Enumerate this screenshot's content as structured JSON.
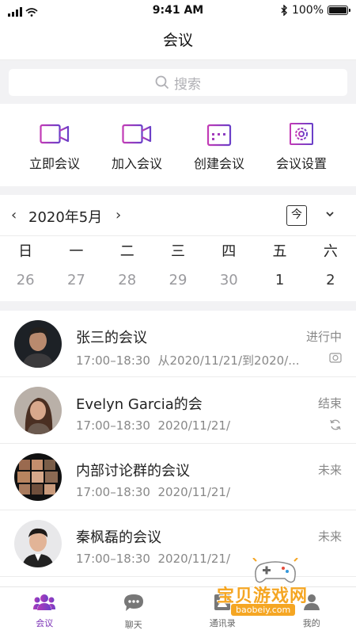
{
  "status_bar": {
    "time": "9:41 AM",
    "battery": "100%"
  },
  "header": {
    "title": "会议"
  },
  "search": {
    "placeholder": "搜索"
  },
  "accent_color": "#8e3bbf",
  "actions": [
    {
      "label": "立即会议",
      "icon": "video-camera-icon"
    },
    {
      "label": "加入会议",
      "icon": "video-camera-plus-icon"
    },
    {
      "label": "创建会议",
      "icon": "calendar-plus-icon"
    },
    {
      "label": "会议设置",
      "icon": "settings-gear-icon"
    }
  ],
  "calendar": {
    "month": "2020年5月",
    "prev": "‹",
    "next": "›",
    "today": "今",
    "weekdays": [
      "日",
      "一",
      "二",
      "三",
      "四",
      "五",
      "六"
    ],
    "dates": [
      "26",
      "27",
      "28",
      "29",
      "30",
      "1",
      "2"
    ]
  },
  "meetings": [
    {
      "title": "张三的会议",
      "time": "17:00–18:30",
      "date": "从2020/11/21/到2020/...",
      "status": "进行中",
      "status_icon": "camera-icon"
    },
    {
      "title": "Evelyn Garcia的会",
      "time": "17:00–18:30",
      "date": "2020/11/21/",
      "status": "结束",
      "status_icon": "refresh-icon"
    },
    {
      "title": "内部讨论群的会议",
      "time": "17:00–18:30",
      "date": "2020/11/21/",
      "status": "未来",
      "status_icon": ""
    },
    {
      "title": "秦枫磊的会议",
      "time": "17:00–18:30",
      "date": "2020/11/21/",
      "status": "未来",
      "status_icon": ""
    }
  ],
  "tabs": [
    {
      "label": "会议",
      "icon": "people-icon",
      "active": true
    },
    {
      "label": "聊天",
      "icon": "chat-bubble-icon",
      "active": false
    },
    {
      "label": "通讯录",
      "icon": "contacts-icon",
      "active": false
    },
    {
      "label": "我的",
      "icon": "person-icon",
      "active": false
    }
  ],
  "watermark": {
    "title": "宝贝游戏网",
    "url": "baobeiy.com"
  }
}
